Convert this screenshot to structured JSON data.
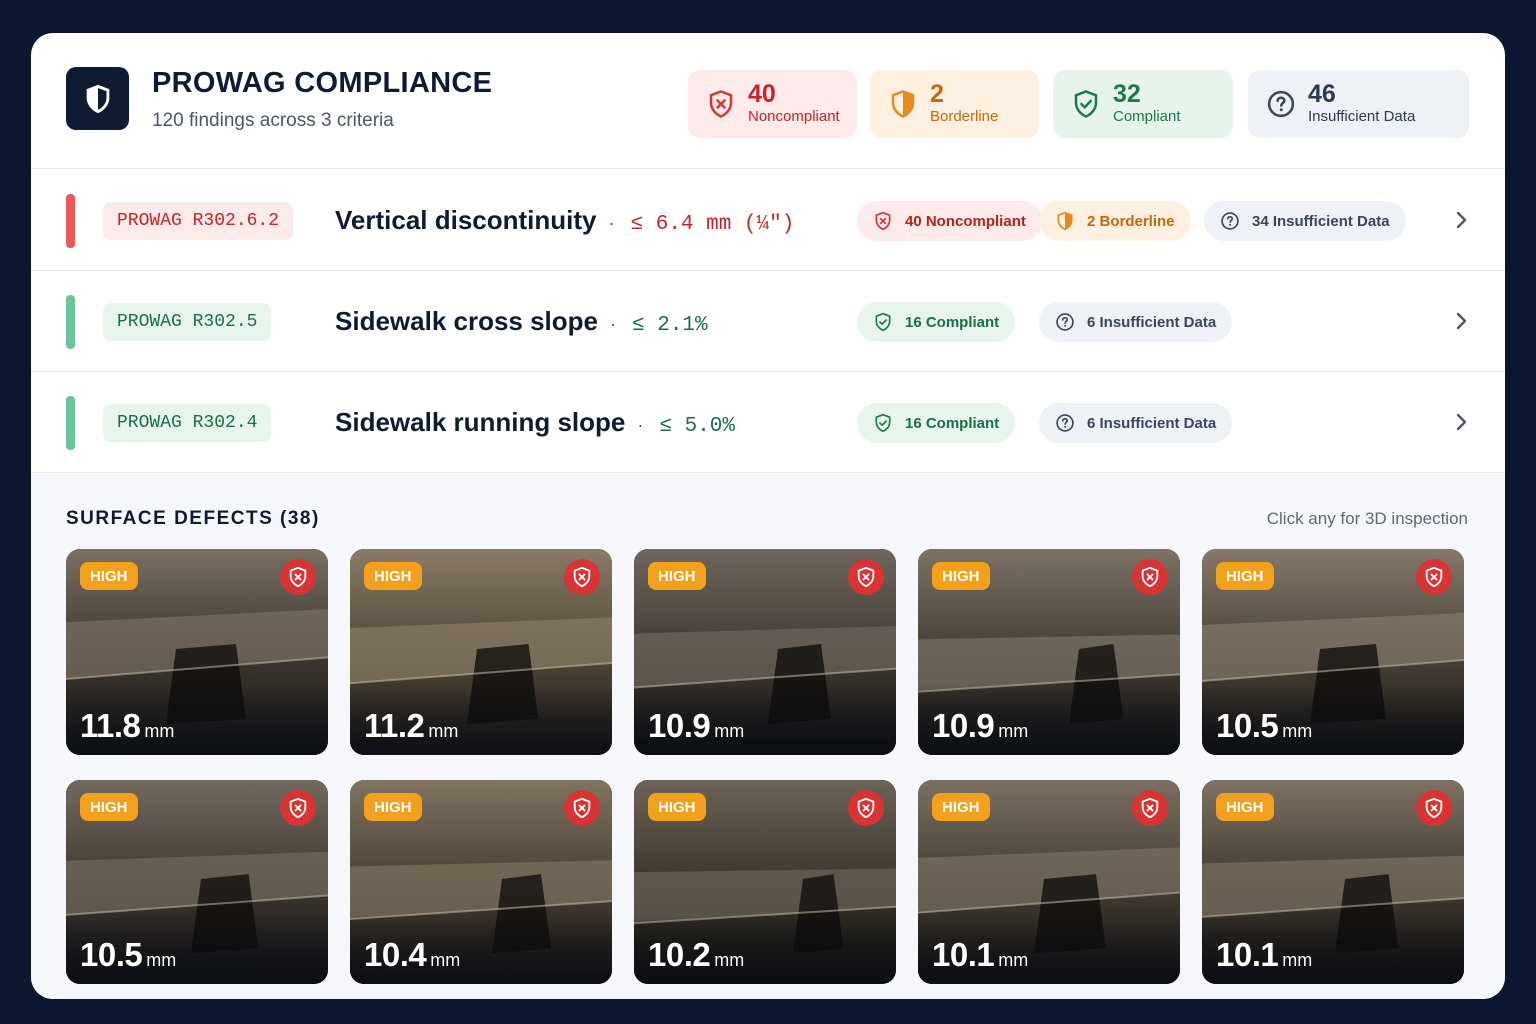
{
  "header": {
    "title": "PROWAG COMPLIANCE",
    "subtitle": "120 findings across 3 criteria",
    "logo_icon": "shield-check-icon"
  },
  "summary": [
    {
      "count": "40",
      "label": "Noncompliant",
      "icon": "shield-x-icon",
      "color": "#c42525"
    },
    {
      "count": "2",
      "label": "Borderline",
      "icon": "shield-half-icon",
      "color": "#e8891c"
    },
    {
      "count": "32",
      "label": "Compliant",
      "icon": "shield-check-icon",
      "color": "#1d7a48"
    },
    {
      "count": "46",
      "label": "Insufficient Data",
      "icon": "question-circle-icon",
      "color": "#2d3a55"
    }
  ],
  "rules": [
    {
      "code": "PROWAG R302.6.2",
      "title": "Vertical discontinuity",
      "threshold": "≤ 6.4 mm (¼\")",
      "status_color": "#e85a5a",
      "pills": [
        "40 Noncompliant",
        "2 Borderline",
        "34 Insufficient Data"
      ]
    },
    {
      "code": "PROWAG R302.5",
      "title": "Sidewalk cross slope",
      "threshold": "≤ 2.1%",
      "status_color": "#6cc49a",
      "pills": [
        "16 Compliant",
        "6 Insufficient Data"
      ]
    },
    {
      "code": "PROWAG R302.4",
      "title": "Sidewalk running slope",
      "threshold": "≤ 5.0%",
      "status_color": "#6cc49a",
      "pills": [
        "16 Compliant",
        "6 Insufficient Data"
      ]
    }
  ],
  "defects": {
    "title": "SURFACE DEFECTS (38)",
    "hint": "Click any for 3D inspection",
    "unit": "mm",
    "items": [
      {
        "severity": "HIGH",
        "value": "11.8"
      },
      {
        "severity": "HIGH",
        "value": "11.2"
      },
      {
        "severity": "HIGH",
        "value": "10.9"
      },
      {
        "severity": "HIGH",
        "value": "10.9"
      },
      {
        "severity": "HIGH",
        "value": "10.5"
      },
      {
        "severity": "HIGH",
        "value": "10.5"
      },
      {
        "severity": "HIGH",
        "value": "10.4"
      },
      {
        "severity": "HIGH",
        "value": "10.2"
      },
      {
        "severity": "HIGH",
        "value": "10.1"
      },
      {
        "severity": "HIGH",
        "value": "10.1"
      }
    ]
  }
}
